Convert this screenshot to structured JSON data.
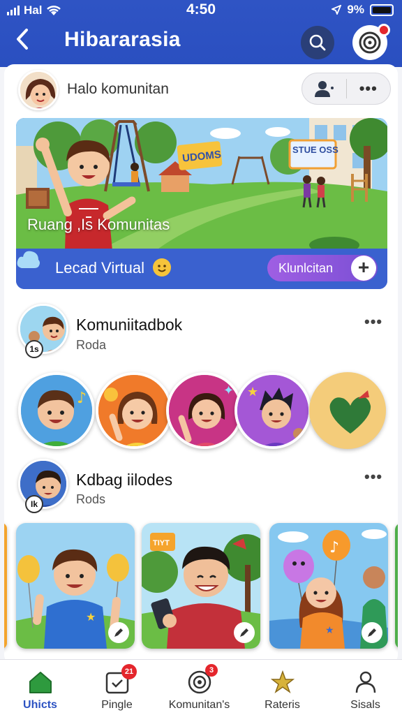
{
  "status_bar": {
    "carrier": "Hal",
    "time": "4:50",
    "battery": "9%"
  },
  "header": {
    "title": "Hibararasia"
  },
  "greeting": {
    "text": "Halo komunitan"
  },
  "banner": {
    "title": "Ruang ,Is Komunitas",
    "sign_left": "UDOMS",
    "sign_right": "STUE OSS",
    "footer_label": "Lecad Virtual",
    "join_label": "Klunlcitan",
    "join_icon": "plus-icon"
  },
  "section1": {
    "title": "Komuniitadbok",
    "subtitle": "Roda",
    "badge": "1s"
  },
  "section2": {
    "title": "Kdbag iilodes",
    "subtitle": "Rods",
    "badge": "Ik"
  },
  "nav": {
    "items": [
      {
        "label": "Uhicts",
        "icon": "home-icon",
        "active": true
      },
      {
        "label": "Pingle",
        "icon": "calendar-icon",
        "badge": "21"
      },
      {
        "label": "Komunitan's",
        "icon": "target-icon",
        "badge": "3"
      },
      {
        "label": "Rateris",
        "icon": "star-icon"
      },
      {
        "label": "Sisals",
        "icon": "person-icon"
      }
    ]
  },
  "colors": {
    "primary": "#2f54c4",
    "accent": "#8f59df",
    "badge": "#e4262c"
  }
}
